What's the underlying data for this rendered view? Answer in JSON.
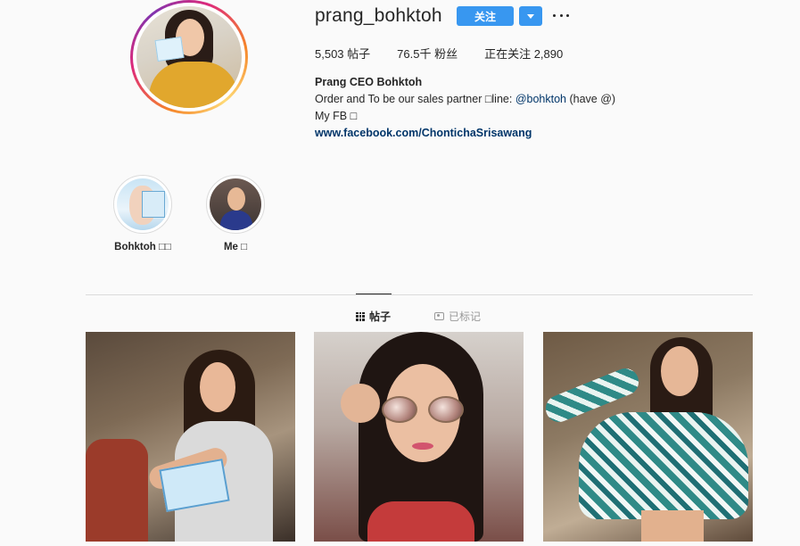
{
  "profile": {
    "username": "prang_bohktoh",
    "follow_label": "关注",
    "stats": {
      "posts": "5,503 帖子",
      "followers": "76.5千 粉丝",
      "following": "正在关注 2,890"
    },
    "bio": {
      "name": "Prang CEO Bohktoh",
      "line1_prefix": "Order and To be our sales partner □line: ",
      "line1_mention": "@bohktoh",
      "line1_suffix": " (have @)",
      "line2": "My FB □",
      "link": "www.facebook.com/ChontichaSrisawang"
    }
  },
  "highlights": [
    {
      "label": "Bohktoh □□"
    },
    {
      "label": "Me □"
    }
  ],
  "tabs": {
    "posts": "帖子",
    "tagged": "已标记"
  },
  "icons": {
    "more": "more-options-icon",
    "dropdown": "chevron-down-icon",
    "posts_tab": "grid-icon",
    "tagged_tab": "tagged-icon"
  },
  "colors": {
    "accent": "#3897f0",
    "link": "#003569",
    "text": "#262626",
    "muted": "#999999",
    "background": "#fafafa"
  }
}
